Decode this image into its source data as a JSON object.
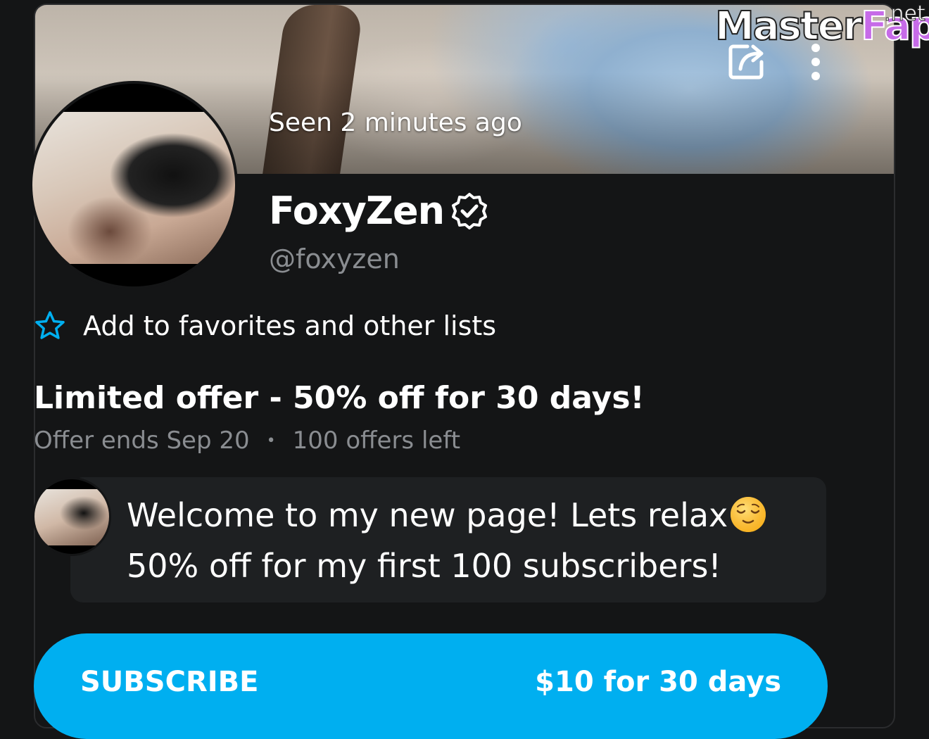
{
  "banner": {
    "status": "Seen 2 minutes ago",
    "share_icon": "share-icon",
    "more_icon": "more-vertical-icon"
  },
  "watermark": {
    "part1": "Master",
    "part2": "Fap",
    "suffix": ".net"
  },
  "profile": {
    "name": "FoxyZen",
    "handle": "@foxyzen",
    "verified_icon": "verified-badge-icon"
  },
  "favorites": {
    "label": "Add to favorites and other lists",
    "icon": "star-icon",
    "accent": "#00aff0"
  },
  "offer": {
    "title": "Limited offer - 50% off for 30 days!",
    "ends": "Offer ends Sep 20",
    "separator": "•",
    "remaining": "100 offers left"
  },
  "message": {
    "text_before": "Welcome to my new page! Lets relax",
    "emoji": "relieved-face-emoji",
    "text_after": " 50% off for my first 100 subscribers!"
  },
  "subscribe": {
    "label": "SUBSCRIBE",
    "price": "$10 for 30 days",
    "color": "#00aff0"
  }
}
